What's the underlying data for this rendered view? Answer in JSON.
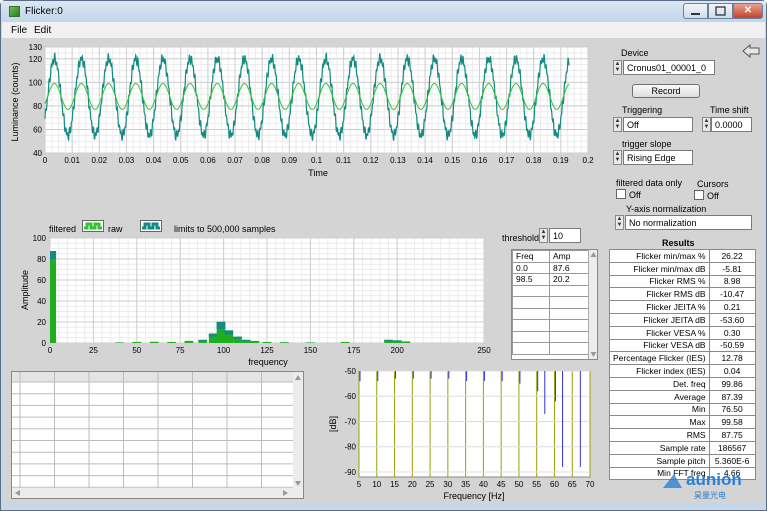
{
  "window": {
    "title": "Flicker:0",
    "close_symbol": "✕"
  },
  "menu": [
    {
      "label": "File"
    },
    {
      "label": "Edit"
    }
  ],
  "device": {
    "label": "Device",
    "value": "Cronus01_00001_0",
    "record_label": "Record"
  },
  "triggering": {
    "label": "Triggering",
    "value": "Off"
  },
  "time_shift": {
    "label": "Time shift",
    "value": "0.0000"
  },
  "trigger_slope": {
    "label": "trigger slope",
    "value": "Rising Edge"
  },
  "filtered_only": {
    "label": "filtered data only",
    "value": "Off"
  },
  "cursors": {
    "label": "Cursors",
    "value": "Off"
  },
  "y_norm": {
    "label": "Y-axis normalization",
    "value": "No normalization"
  },
  "results": {
    "title": "Results",
    "rows": [
      {
        "name": "Flicker min/max %",
        "value": "26.22"
      },
      {
        "name": "Flicker min/max dB",
        "value": "-5.81"
      },
      {
        "name": "Flicker RMS %",
        "value": "8.98"
      },
      {
        "name": "Flicker RMS dB",
        "value": "-10.47"
      },
      {
        "name": "Flicker JEITA %",
        "value": "0.21"
      },
      {
        "name": "Flicker JEITA dB",
        "value": "-53.60"
      },
      {
        "name": "Flicker VESA %",
        "value": "0.30"
      },
      {
        "name": "Flicker VESA dB",
        "value": "-50.59"
      },
      {
        "name": "Percentage Flicker (IES)",
        "value": "12.78"
      },
      {
        "name": "Flicker index (IES)",
        "value": "0.04"
      },
      {
        "name": "Det. freq",
        "value": "99.86"
      },
      {
        "name": "Average",
        "value": "87.39"
      },
      {
        "name": "Min",
        "value": "76.50"
      },
      {
        "name": "Max",
        "value": "99.58"
      },
      {
        "name": "RMS",
        "value": "87.75"
      },
      {
        "name": "Sample rate",
        "value": "186567"
      },
      {
        "name": "Sample pitch",
        "value": "5.360E-6"
      },
      {
        "name": "Min FFT freq",
        "value": "4.66"
      }
    ]
  },
  "threshold": {
    "label": "threshold",
    "value": "10"
  },
  "peaks": {
    "headers": [
      "Freq",
      "Amp"
    ],
    "rows": [
      [
        "0.0",
        "87.6"
      ],
      [
        "98.5",
        "20.2"
      ]
    ]
  },
  "legend": {
    "filtered_label": "filtered",
    "raw_label": "raw",
    "limit_note": "limits to 500,000 samples"
  },
  "watermark": {
    "brand": "aunion",
    "sub": "昊量光电"
  },
  "colors": {
    "raw": "#138a82",
    "filtered": "#33c233",
    "fft": "#1fae1f",
    "db_lines": "#9aa000",
    "db_markers": "#3030d8"
  },
  "chart_data": [
    {
      "type": "line",
      "title": "",
      "xlabel": "Time",
      "ylabel": "Luminance (counts)",
      "xlim": [
        0,
        0.2
      ],
      "ylim": [
        40,
        130
      ],
      "xticks": [
        "0",
        "0.01",
        "0.02",
        "0.03",
        "0.04",
        "0.05",
        "0.06",
        "0.07",
        "0.08",
        "0.09",
        "0.1",
        "0.11",
        "0.12",
        "0.13",
        "0.14",
        "0.15",
        "0.16",
        "0.17",
        "0.18",
        "0.19",
        "0.2"
      ],
      "yticks": [
        "40",
        "60",
        "80",
        "100",
        "120",
        "130"
      ],
      "grid": true,
      "series": [
        {
          "name": "raw",
          "frequency_hz": 100,
          "mean": 87.5,
          "amplitude": 32.5,
          "x_end": 0.193
        },
        {
          "name": "filtered",
          "frequency_hz": 100,
          "mean": 88,
          "amplitude": 11,
          "x_end": 0.193
        }
      ]
    },
    {
      "type": "bar",
      "title": "",
      "xlabel": "frequency",
      "ylabel": "Amplitude",
      "xlim": [
        0,
        250
      ],
      "ylim": [
        0,
        100
      ],
      "xticks": [
        "0",
        "25",
        "50",
        "75",
        "100",
        "125",
        "150",
        "175",
        "200",
        "250"
      ],
      "yticks": [
        "0",
        "20",
        "40",
        "60",
        "80",
        "100"
      ],
      "grid": true,
      "bars": [
        {
          "x": 0,
          "value": 87.6
        },
        {
          "x": 40,
          "value": 0.6
        },
        {
          "x": 50,
          "value": 1
        },
        {
          "x": 60,
          "value": 1.2
        },
        {
          "x": 70,
          "value": 1
        },
        {
          "x": 80,
          "value": 2
        },
        {
          "x": 88,
          "value": 3
        },
        {
          "x": 94,
          "value": 9
        },
        {
          "x": 98.5,
          "value": 20.2
        },
        {
          "x": 103,
          "value": 12
        },
        {
          "x": 108,
          "value": 6
        },
        {
          "x": 113,
          "value": 3
        },
        {
          "x": 118,
          "value": 2
        },
        {
          "x": 125,
          "value": 1
        },
        {
          "x": 135,
          "value": 0.8
        },
        {
          "x": 150,
          "value": 0.6
        },
        {
          "x": 170,
          "value": 1
        },
        {
          "x": 195,
          "value": 3
        },
        {
          "x": 200,
          "value": 2.5
        },
        {
          "x": 205,
          "value": 1.5
        }
      ]
    },
    {
      "type": "bar",
      "title": "",
      "xlabel": "Frequency [Hz]",
      "ylabel": "[dB]",
      "xlim": [
        5,
        70
      ],
      "ylim": [
        -92,
        -50
      ],
      "xticks": [
        "5",
        "10",
        "15",
        "20",
        "25",
        "30",
        "35",
        "40",
        "45",
        "50",
        "55",
        "60",
        "65",
        "70"
      ],
      "yticks": [
        "-50",
        "-60",
        "-70",
        "-80",
        "-90"
      ],
      "grid": true,
      "markers": [
        {
          "x": 5,
          "value": -54
        },
        {
          "x": 10,
          "value": -54
        },
        {
          "x": 15,
          "value": -53
        },
        {
          "x": 20,
          "value": -53
        },
        {
          "x": 25,
          "value": -53
        },
        {
          "x": 30,
          "value": -53
        },
        {
          "x": 35,
          "value": -54
        },
        {
          "x": 40,
          "value": -54
        },
        {
          "x": 45,
          "value": -54
        },
        {
          "x": 50,
          "value": -55
        },
        {
          "x": 55,
          "value": -58
        },
        {
          "x": 57,
          "value": -67
        },
        {
          "x": 60,
          "value": -62
        },
        {
          "x": 62,
          "value": -88
        },
        {
          "x": 67,
          "value": -88
        }
      ]
    }
  ]
}
